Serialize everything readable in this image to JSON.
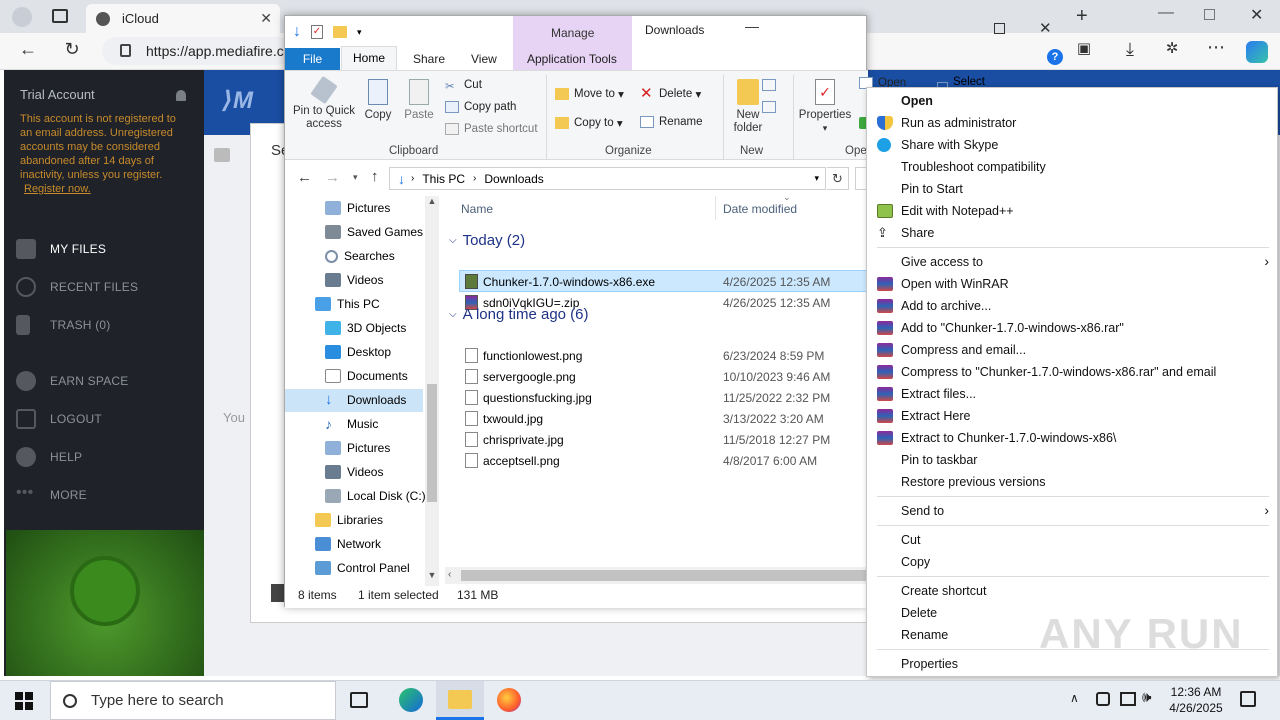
{
  "browser": {
    "tab_icloud": "iCloud",
    "url": "https://app.mediafire.c"
  },
  "mediafire": {
    "trial_title": "Trial Account",
    "trial_msg": "This account is not registered to an email address. Unregistered accounts may be considered abandoned after 14 days of inactivity, unless you register.",
    "register_link": "Register now.",
    "menu": [
      "MY FILES",
      "RECENT FILES",
      "TRASH (0)",
      "EARN SPACE",
      "LOGOUT",
      "HELP",
      "MORE"
    ],
    "panel_text_se": "Se",
    "panel_text_you": "You"
  },
  "explorer": {
    "title": "Downloads",
    "manage_tab": "Manage",
    "tabs": [
      "File",
      "Home",
      "Share",
      "View",
      "Application Tools"
    ],
    "ribbon": {
      "pin": "Pin to Quick access",
      "copy": "Copy",
      "paste": "Paste",
      "cut": "Cut",
      "copy_path": "Copy path",
      "paste_shortcut": "Paste shortcut",
      "clipboard": "Clipboard",
      "move_to": "Move to",
      "copy_to": "Copy to",
      "delete": "Delete",
      "rename": "Rename",
      "organize": "Organize",
      "new_folder": "New folder",
      "new": "New",
      "properties": "Properties",
      "open": "Open",
      "select_all": "Select all",
      "open_group": "Ope"
    },
    "path": [
      "This PC",
      "Downloads"
    ],
    "nav": [
      "Pictures",
      "Saved Games",
      "Searches",
      "Videos",
      "This PC",
      "3D Objects",
      "Desktop",
      "Documents",
      "Downloads",
      "Music",
      "Pictures",
      "Videos",
      "Local Disk (C:)",
      "Libraries",
      "Network",
      "Control Panel"
    ],
    "columns": {
      "name": "Name",
      "date": "Date modified"
    },
    "groups": {
      "today": "Today (2)",
      "long_ago": "A long time ago (6)"
    },
    "files_today": [
      {
        "name": "Chunker-1.7.0-windows-x86.exe",
        "date": "4/26/2025 12:35 AM"
      },
      {
        "name": "sdn0iVqkIGU=.zip",
        "date": "4/26/2025 12:35 AM"
      }
    ],
    "files_old": [
      {
        "name": "functionlowest.png",
        "date": "6/23/2024 8:59 PM"
      },
      {
        "name": "servergoogle.png",
        "date": "10/10/2023 9:46 AM"
      },
      {
        "name": "questionsfucking.jpg",
        "date": "11/25/2022 2:32 PM"
      },
      {
        "name": "txwould.jpg",
        "date": "3/13/2022 3:20 AM"
      },
      {
        "name": "chrisprivate.jpg",
        "date": "11/5/2018 12:27 PM"
      },
      {
        "name": "acceptsell.png",
        "date": "4/8/2017 6:00 AM"
      }
    ],
    "status": {
      "count": "8 items",
      "selected": "1 item selected",
      "size": "131 MB"
    }
  },
  "context_menu": [
    "Open",
    "Run as administrator",
    "Share with Skype",
    "Troubleshoot compatibility",
    "Pin to Start",
    "Edit with Notepad++",
    "Share",
    "Give access to",
    "Open with WinRAR",
    "Add to archive...",
    "Add to \"Chunker-1.7.0-windows-x86.rar\"",
    "Compress and email...",
    "Compress to \"Chunker-1.7.0-windows-x86.rar\" and email",
    "Extract files...",
    "Extract Here",
    "Extract to Chunker-1.7.0-windows-x86\\",
    "Pin to taskbar",
    "Restore previous versions",
    "Send to",
    "Cut",
    "Copy",
    "Create shortcut",
    "Delete",
    "Rename",
    "Properties"
  ],
  "taskbar": {
    "search_placeholder": "Type here to search",
    "time": "12:36 AM",
    "date": "4/26/2025"
  },
  "watermark": "ANY RUN"
}
